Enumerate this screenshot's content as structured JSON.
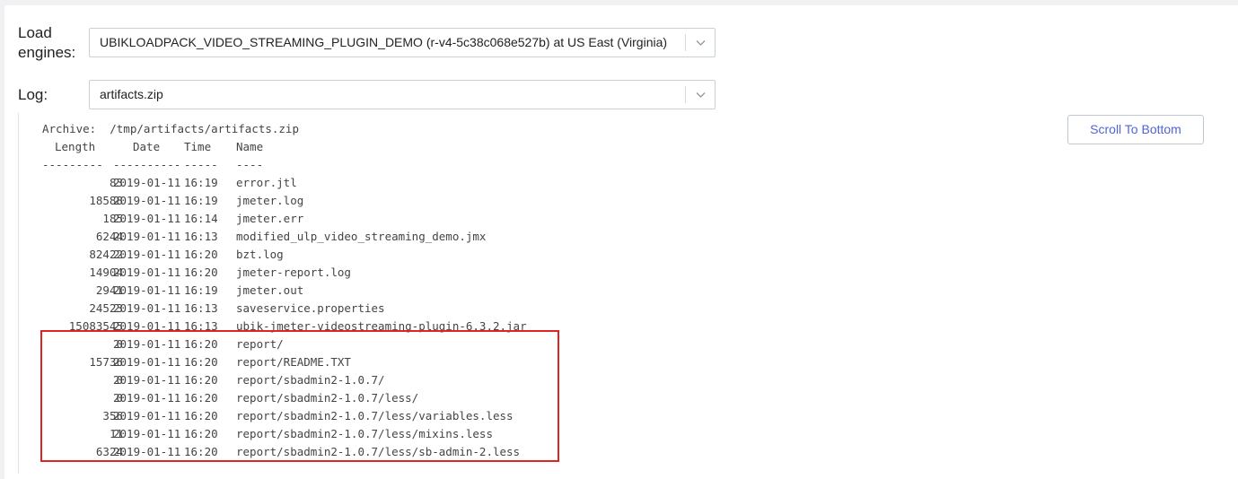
{
  "form": {
    "engines_label": "Load engines:",
    "engines_value": "UBIKLOADPACK_VIDEO_STREAMING_PLUGIN_DEMO (r-v4-5c38c068e527b) at US East (Virginia)",
    "log_label": "Log:",
    "log_value": "artifacts.zip"
  },
  "toolbar": {
    "scroll_label": "Scroll To Bottom"
  },
  "log": {
    "archive_line": "Archive:  /tmp/artifacts/artifacts.zip",
    "headers": {
      "length": "Length",
      "date": "Date",
      "time": "Time",
      "name": "Name"
    },
    "separators": {
      "length": "---------",
      "date": "----------",
      "time": "-----",
      "name": "----"
    },
    "rows": [
      {
        "length": "83",
        "date": "2019-01-11",
        "time": "16:19",
        "name": "error.jtl"
      },
      {
        "length": "18588",
        "date": "2019-01-11",
        "time": "16:19",
        "name": "jmeter.log"
      },
      {
        "length": "185",
        "date": "2019-01-11",
        "time": "16:14",
        "name": "jmeter.err"
      },
      {
        "length": "6244",
        "date": "2019-01-11",
        "time": "16:13",
        "name": "modified_ulp_video_streaming_demo.jmx"
      },
      {
        "length": "82422",
        "date": "2019-01-11",
        "time": "16:20",
        "name": "bzt.log"
      },
      {
        "length": "14904",
        "date": "2019-01-11",
        "time": "16:20",
        "name": "jmeter-report.log"
      },
      {
        "length": "2941",
        "date": "2019-01-11",
        "time": "16:19",
        "name": "jmeter.out"
      },
      {
        "length": "24523",
        "date": "2019-01-11",
        "time": "16:13",
        "name": "saveservice.properties"
      },
      {
        "length": "15083545",
        "date": "2019-01-11",
        "time": "16:13",
        "name": "ubik-jmeter-videostreaming-plugin-6.3.2.jar"
      },
      {
        "length": "0",
        "date": "2019-01-11",
        "time": "16:20",
        "name": "report/"
      },
      {
        "length": "15736",
        "date": "2019-01-11",
        "time": "16:20",
        "name": "report/README.TXT"
      },
      {
        "length": "0",
        "date": "2019-01-11",
        "time": "16:20",
        "name": "report/sbadmin2-1.0.7/"
      },
      {
        "length": "0",
        "date": "2019-01-11",
        "time": "16:20",
        "name": "report/sbadmin2-1.0.7/less/"
      },
      {
        "length": "356",
        "date": "2019-01-11",
        "time": "16:20",
        "name": "report/sbadmin2-1.0.7/less/variables.less"
      },
      {
        "length": "11",
        "date": "2019-01-11",
        "time": "16:20",
        "name": "report/sbadmin2-1.0.7/less/mixins.less"
      },
      {
        "length": "6324",
        "date": "2019-01-11",
        "time": "16:20",
        "name": "report/sbadmin2-1.0.7/less/sb-admin-2.less"
      }
    ]
  },
  "colors": {
    "accent": "#4f66d6",
    "highlight": "#e02424"
  },
  "icons": {
    "dropdown": "chevron-down-icon"
  }
}
